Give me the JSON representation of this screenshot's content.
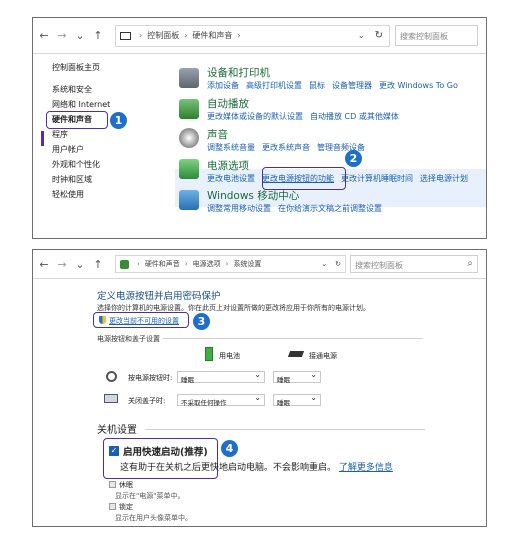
{
  "panel1": {
    "address": {
      "back": "←",
      "forward": "→",
      "down": "⌄",
      "up": "↑",
      "crumbs": [
        "控制面板",
        "硬件和声音"
      ],
      "dropdown": "⌄",
      "refresh": "↻",
      "search_placeholder": "搜索控制面板"
    },
    "sidebar": {
      "home": "控制面板主页",
      "items": [
        "系统和安全",
        "网络和 Internet",
        "硬件和声音",
        "程序",
        "用户帐户",
        "外观和个性化",
        "时钟和区域",
        "轻松使用"
      ]
    },
    "categories": [
      {
        "title": "设备和打印机",
        "links": [
          "添加设备",
          "高级打印机设置",
          "鼠标",
          "设备管理器",
          "更改 Windows To Go"
        ]
      },
      {
        "title": "自动播放",
        "links": [
          "更改媒体或设备的默认设置",
          "自动播放 CD 或其他媒体"
        ]
      },
      {
        "title": "声音",
        "links": [
          "调整系统音量",
          "更改系统声音",
          "管理音频设备"
        ]
      },
      {
        "title": "电源选项",
        "links": [
          "更改电池设置",
          "更改电源按钮的功能",
          "更改计算机睡眠时间",
          "选择电源计划"
        ]
      },
      {
        "title": "Windows 移动中心",
        "links": [
          "调整常用移动设置",
          "在你给演示文稿之前调整设置"
        ]
      }
    ],
    "badges": [
      "1",
      "2"
    ]
  },
  "panel2": {
    "address": {
      "crumbs": [
        "硬件和声音",
        "电源选项",
        "系统设置"
      ],
      "search_placeholder": "搜索控制面板"
    },
    "heading": "定义电源按钮并启用密码保护",
    "description": "选择你的计算机的电源设置。你在此页上对设置所做的更改将应用于你所有的电源计划。",
    "unavailable_link": "更改当前不可用的设置",
    "section_buttons": "电源按钮和盖子设置",
    "col_battery": "用电池",
    "col_plugged": "接通电源",
    "rows": [
      {
        "label": "按电源按钮时:",
        "battery": "睡眠",
        "plugged": "睡眠"
      },
      {
        "label": "关闭盖子时:",
        "battery": "不采取任何操作",
        "plugged": "睡眠"
      }
    ],
    "shutdown_title": "关机设置",
    "fast_startup": {
      "label": "启用快速启动(推荐)",
      "desc": "这有助于在关机之后更快地启动电脑。不会影响重启。",
      "learn": "了解更多信息",
      "checked": true
    },
    "sleep": {
      "label": "休眠",
      "desc": "显示在\"电源\"菜单中。"
    },
    "lock": {
      "label": "锁定",
      "desc": "显示在用户头像菜单中。"
    },
    "badges": [
      "3",
      "4"
    ]
  },
  "colors": {
    "accent": "#4d2f9e",
    "badge": "#1e6fc8",
    "link": "#1a5fb4",
    "title_green": "#1c6b3c"
  }
}
